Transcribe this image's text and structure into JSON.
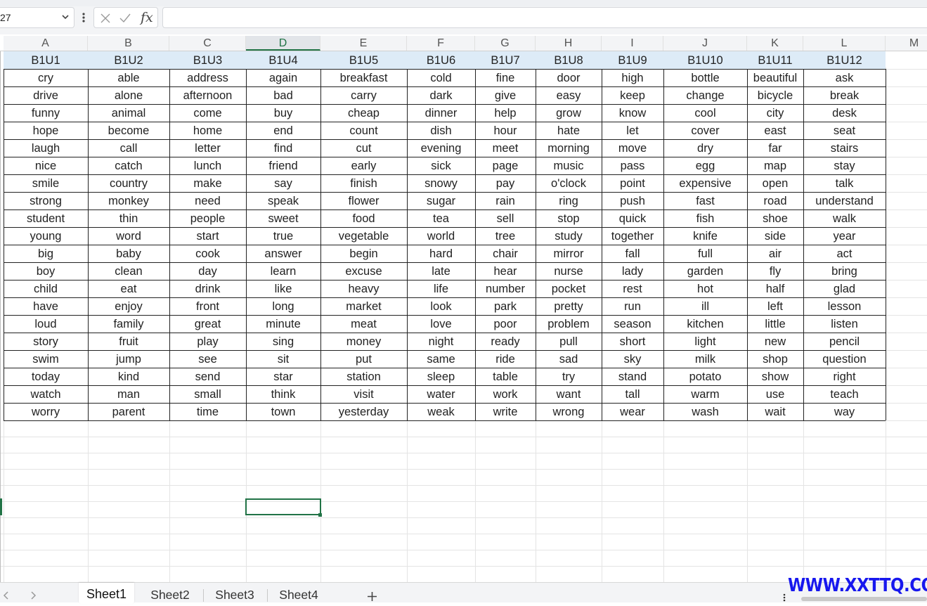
{
  "formula_bar": {
    "name_box_value": "27",
    "fx_label": "fx",
    "formula_value": ""
  },
  "columns": [
    "A",
    "B",
    "C",
    "D",
    "E",
    "F",
    "G",
    "H",
    "I",
    "J",
    "K",
    "L",
    "M"
  ],
  "selected_column": "D",
  "table": {
    "headers": [
      "B1U1",
      "B1U2",
      "B1U3",
      "B1U4",
      "B1U5",
      "B1U6",
      "B1U7",
      "B1U8",
      "B1U9",
      "B1U10",
      "B1U11",
      "B1U12"
    ],
    "rows": [
      [
        "cry",
        "able",
        "address",
        "again",
        "breakfast",
        "cold",
        "fine",
        "door",
        "high",
        "bottle",
        "beautiful",
        "ask"
      ],
      [
        "drive",
        "alone",
        "afternoon",
        "bad",
        "carry",
        "dark",
        "give",
        "easy",
        "keep",
        "change",
        "bicycle",
        "break"
      ],
      [
        "funny",
        "animal",
        "come",
        "buy",
        "cheap",
        "dinner",
        "help",
        "grow",
        "know",
        "cool",
        "city",
        "desk"
      ],
      [
        "hope",
        "become",
        "home",
        "end",
        "count",
        "dish",
        "hour",
        "hate",
        "let",
        "cover",
        "east",
        "seat"
      ],
      [
        "laugh",
        "call",
        "letter",
        "find",
        "cut",
        "evening",
        "meet",
        "morning",
        "move",
        "dry",
        "far",
        "stairs"
      ],
      [
        "nice",
        "catch",
        "lunch",
        "friend",
        "early",
        "sick",
        "page",
        "music",
        "pass",
        "egg",
        "map",
        "stay"
      ],
      [
        "smile",
        "country",
        "make",
        "say",
        "finish",
        "snowy",
        "pay",
        "o'clock",
        "point",
        "expensive",
        "open",
        "talk"
      ],
      [
        "strong",
        "monkey",
        "need",
        "speak",
        "flower",
        "sugar",
        "rain",
        "ring",
        "push",
        "fast",
        "road",
        "understand"
      ],
      [
        "student",
        "thin",
        "people",
        "sweet",
        "food",
        "tea",
        "sell",
        "stop",
        "quick",
        "fish",
        "shoe",
        "walk"
      ],
      [
        "young",
        "word",
        "start",
        "true",
        "vegetable",
        "world",
        "tree",
        "study",
        "together",
        "knife",
        "side",
        "year"
      ],
      [
        "big",
        "baby",
        "cook",
        "answer",
        "begin",
        "hard",
        "chair",
        "mirror",
        "fall",
        "full",
        "air",
        "act"
      ],
      [
        "boy",
        "clean",
        "day",
        "learn",
        "excuse",
        "late",
        "hear",
        "nurse",
        "lady",
        "garden",
        "fly",
        "bring"
      ],
      [
        "child",
        "eat",
        "drink",
        "like",
        "heavy",
        "life",
        "number",
        "pocket",
        "rest",
        "hot",
        "half",
        "glad"
      ],
      [
        "have",
        "enjoy",
        "front",
        "long",
        "market",
        "look",
        "park",
        "pretty",
        "run",
        "ill",
        "left",
        "lesson"
      ],
      [
        "loud",
        "family",
        "great",
        "minute",
        "meat",
        "love",
        "poor",
        "problem",
        "season",
        "kitchen",
        "little",
        "listen"
      ],
      [
        "story",
        "fruit",
        "play",
        "sing",
        "money",
        "night",
        "ready",
        "pull",
        "short",
        "light",
        "new",
        "pencil"
      ],
      [
        "swim",
        "jump",
        "see",
        "sit",
        "put",
        "same",
        "ride",
        "sad",
        "sky",
        "milk",
        "shop",
        "question"
      ],
      [
        "today",
        "kind",
        "send",
        "star",
        "station",
        "sleep",
        "table",
        "try",
        "stand",
        "potato",
        "show",
        "right"
      ],
      [
        "watch",
        "man",
        "small",
        "think",
        "visit",
        "water",
        "work",
        "want",
        "tall",
        "warm",
        "use",
        "teach"
      ],
      [
        "worry",
        "parent",
        "time",
        "town",
        "yesterday",
        "weak",
        "write",
        "wrong",
        "wear",
        "wash",
        "wait",
        "way"
      ]
    ]
  },
  "sheet_tabs": {
    "items": [
      "Sheet1",
      "Sheet2",
      "Sheet3",
      "Sheet4"
    ],
    "active": "Sheet1",
    "add_label": "+"
  },
  "watermark": "WWW.XXTTQ.COM",
  "colors": {
    "header_fill": "#ddebf7",
    "selection_green": "#217346",
    "watermark_blue": "#1717ee"
  }
}
